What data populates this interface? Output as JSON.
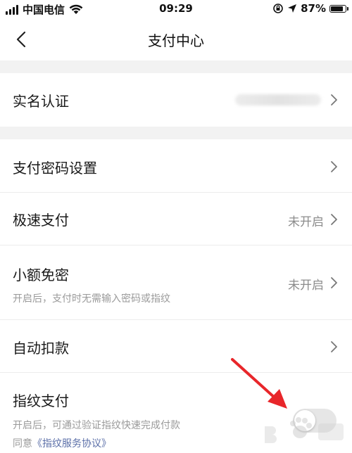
{
  "status_bar": {
    "carrier": "中国电信",
    "time": "09:29",
    "battery": "87%",
    "battery_level": 0.87
  },
  "nav": {
    "title": "支付中心"
  },
  "rows": {
    "real_name": {
      "label": "实名认证"
    },
    "pay_password": {
      "label": "支付密码设置"
    },
    "fast_pay": {
      "label": "极速支付",
      "value": "未开启"
    },
    "small_free": {
      "label": "小额免密",
      "sub": "开启后，支付时无需输入密码或指纹",
      "value": "未开启"
    },
    "auto_deduct": {
      "label": "自动扣款"
    },
    "fingerprint": {
      "label": "指纹支付",
      "sub": "开启后，可通过验证指纹快速完成付款",
      "agree_prefix": "同意",
      "agree_link": "《指纹服务协议》",
      "toggle_on": false
    }
  },
  "colors": {
    "annotation_arrow": "#e8262a",
    "link": "#5b6fa8",
    "secondary_text": "#9a9a9a"
  }
}
